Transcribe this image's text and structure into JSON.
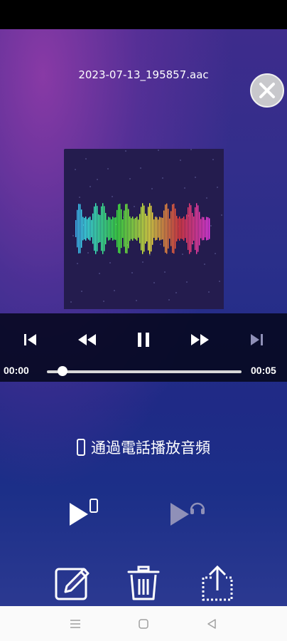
{
  "file": {
    "name": "2023-07-13_195857.aac"
  },
  "player": {
    "time_current": "00:00",
    "time_total": "00:05",
    "progress": 0.08
  },
  "output": {
    "label": "通過電話播放音頻"
  },
  "icons": {
    "close": "close-icon",
    "prev": "skip-previous-icon",
    "rewind": "rewind-icon",
    "pause": "pause-icon",
    "forward": "fast-forward-icon",
    "next": "skip-next-icon",
    "play_phone": "play-on-phone-icon",
    "play_headset": "play-on-headset-icon",
    "edit": "edit-icon",
    "delete": "trash-icon",
    "share": "share-icon"
  },
  "colors": {
    "accent": "#ffffff",
    "disabled": "#8f90b8"
  }
}
